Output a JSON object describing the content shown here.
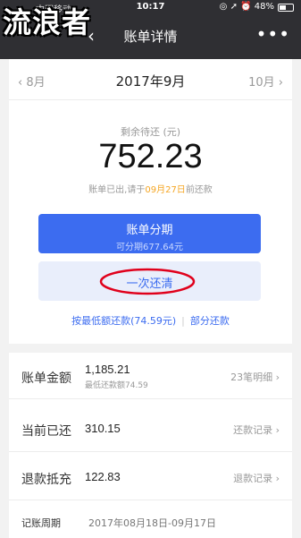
{
  "status_bar": {
    "carrier": "中国移动",
    "time": "10:17",
    "icons": "◎ ➚ ⏰ 48%"
  },
  "watermark": "流浪者",
  "nav": {
    "back_icon": "‹",
    "title": "账单详情",
    "more_icon": "•••"
  },
  "month_nav": {
    "prev": "‹ 8月",
    "current": "2017年9月",
    "next": "10月 ›"
  },
  "summary": {
    "remaining_label": "剩余待还 (元)",
    "remaining_amount": "752.23",
    "due_prefix": "账单已出,请于",
    "due_date": "09月27日",
    "due_suffix": "前还款"
  },
  "buttons": {
    "installment": "账单分期",
    "installment_sub": "可分期677.64元",
    "pay_once": "一次还清"
  },
  "links": {
    "min_pay": "按最低额还款(74.59元)",
    "partial_pay": "部分还款"
  },
  "rows": [
    {
      "key": "账单金额",
      "value": "1,185.21",
      "sub": "最低还款额74.59",
      "right": "23笔明细 ›"
    },
    {
      "key": "当前已还",
      "value": "310.15",
      "right": "还款记录 ›"
    },
    {
      "key": "退款抵充",
      "value": "122.83",
      "right": "退款记录 ›"
    }
  ],
  "period": {
    "key": "记账周期",
    "value": "2017年08月18日-09月17日"
  },
  "colors": {
    "accent": "#3c6cf0",
    "highlight": "#f5a623",
    "annotation": "#e0001b",
    "nav_bg": "#2f2f33"
  }
}
